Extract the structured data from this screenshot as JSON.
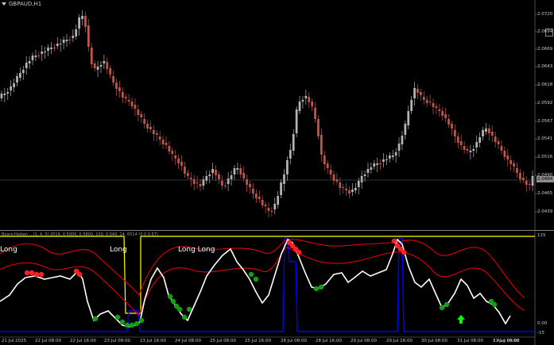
{
  "symbol": {
    "name": "GBPAUD,H1"
  },
  "price_axis": {
    "labels": [
      "2.0720",
      "2.0694",
      "2.0669",
      "2.0643",
      "2.0618",
      "2.0592",
      "2.0567",
      "2.0541",
      "2.0516",
      "2.0490",
      "2.0465",
      "2.0439"
    ],
    "current_price": "2.0484"
  },
  "indicator": {
    "header": "Bears-Heiken ...(1, 4, 3) 2019, 0.5000, 0.5800, 100, 0.040, 14, 6514 (0.0 0.57)",
    "axis_labels": [
      "115",
      "0.00",
      "-15"
    ],
    "signals": [
      "Long",
      "Long",
      "Long Long"
    ]
  },
  "time_axis": {
    "labels": [
      "21 Jul 2025",
      "22 Jul 08:00",
      "22 Jul 16:00",
      "23 Jul 08:00",
      "23 Jul 16:00",
      "24 Jul 08:00",
      "25 Jul 08:00",
      "25 Jul 16:00",
      "28 Jul 08:00",
      "28 Jul 16:00",
      "29 Jul 08:00",
      "29 Jul 16:00",
      "30 Jul 08:00",
      "31 Jul 08:00",
      "31 Jul 16:00",
      "1 Aug 08:00"
    ]
  },
  "colors": {
    "background": "#000000",
    "bull_candle": "#b4b4b4",
    "bear_candle": "#c0574a",
    "white_line": "#ffffff",
    "blue_line": "#0000ff",
    "yellow_line": "#ffff00",
    "red_band": "#e00000",
    "red_dot": "#ff2020",
    "green_dot": "#10a010",
    "arrow": "#00ff00"
  }
}
